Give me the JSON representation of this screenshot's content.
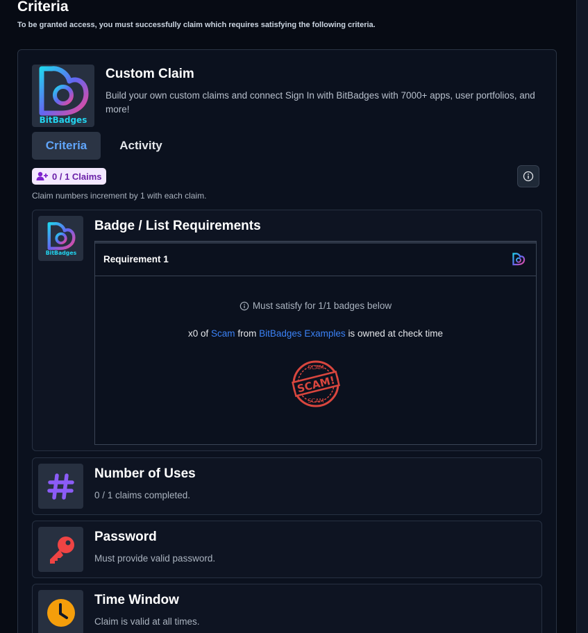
{
  "header": {
    "title": "Criteria",
    "subtitle": "To be granted access, you must successfully claim which requires satisfying the following criteria."
  },
  "claim": {
    "logo_text": "BitBadges",
    "title": "Custom Claim",
    "description": "Build your own custom claims and connect Sign In with BitBadges with 7000+ apps, user portfolios, and more!",
    "tabs": [
      {
        "label": "Criteria",
        "active": true
      },
      {
        "label": "Activity",
        "active": false
      }
    ],
    "claims_count": "0 / 1 Claims",
    "increment_note": "Claim numbers increment by 1 with each claim."
  },
  "badge_requirements": {
    "title": "Badge / List Requirements",
    "icon_text": "BitBadges",
    "requirement": {
      "title": "Requirement 1",
      "note": "Must satisfy for 1/1 badges below",
      "line_prefix": "x0 of",
      "badge_link": "Scam",
      "line_middle": "from",
      "collection_link": "BitBadges Examples",
      "line_suffix": "is owned at check time",
      "stamp_top": "SCAM",
      "stamp_main": "SCAM!",
      "stamp_bottom": "SCAM"
    }
  },
  "sections": [
    {
      "title": "Number of Uses",
      "desc": "0 / 1 claims completed.",
      "icon": "hashtag-icon"
    },
    {
      "title": "Password",
      "desc": "Must provide valid password.",
      "icon": "key-icon"
    },
    {
      "title": "Time Window",
      "desc": "Claim is valid at all times.",
      "icon": "clock-icon"
    }
  ],
  "colors": {
    "accent_blue": "#60a5fa",
    "link_blue": "#3b82f6",
    "hashtag_purple": "#8b5cf6",
    "key_red": "#ef4444",
    "clock_orange": "#f59e0b",
    "stamp_red": "#d9463e"
  }
}
